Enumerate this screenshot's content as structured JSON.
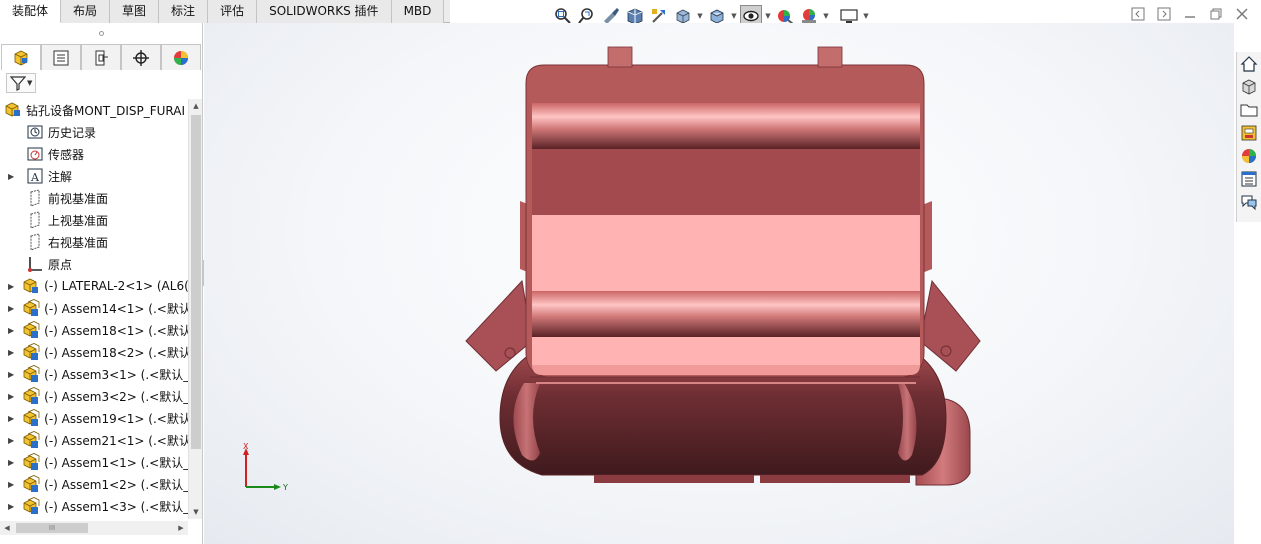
{
  "command_tabs": [
    {
      "label": "装配体",
      "active": true
    },
    {
      "label": "布局",
      "active": false
    },
    {
      "label": "草图",
      "active": false
    },
    {
      "label": "标注",
      "active": false
    },
    {
      "label": "评估",
      "active": false
    },
    {
      "label": "SOLIDWORKS 插件",
      "active": false
    },
    {
      "label": "MBD",
      "active": false
    }
  ],
  "view_toolbar": {
    "icons": [
      "zoom-to-fit-icon",
      "zoom-to-area-icon",
      "previous-view-icon",
      "section-view-icon",
      "dynamic-annotation-icon",
      "view-orientation-icon",
      "display-style-icon",
      "hide-show-items-icon",
      "edit-appearance-icon",
      "apply-scene-icon",
      "view-settings-icon"
    ]
  },
  "property_tabs": [
    "featuremanager-tree-icon",
    "propertymanager-icon",
    "configurationmanager-icon",
    "dimxpertmanager-icon",
    "displaymanager-icon"
  ],
  "tree": {
    "root": "钻孔设备MONT_DISP_FURAI",
    "items": [
      {
        "label": "历史记录",
        "icon": "history-icon",
        "expandable": false
      },
      {
        "label": "传感器",
        "icon": "sensor-icon",
        "expandable": false
      },
      {
        "label": "注解",
        "icon": "annotation-icon",
        "expandable": true
      },
      {
        "label": "前视基准面",
        "icon": "plane-icon",
        "expandable": false
      },
      {
        "label": "上视基准面",
        "icon": "plane-icon",
        "expandable": false
      },
      {
        "label": "右视基准面",
        "icon": "plane-icon",
        "expandable": false
      },
      {
        "label": "原点",
        "icon": "origin-icon",
        "expandable": false
      },
      {
        "label": "(-) LATERAL-2<1> (AL6(",
        "icon": "part-icon",
        "expandable": true
      },
      {
        "label": "(-) Assem14<1> (.<默认",
        "icon": "subassembly-icon",
        "expandable": true
      },
      {
        "label": "(-) Assem18<1> (.<默认",
        "icon": "subassembly-icon",
        "expandable": true
      },
      {
        "label": "(-) Assem18<2> (.<默认",
        "icon": "subassembly-icon",
        "expandable": true
      },
      {
        "label": "(-) Assem3<1> (.<默认_",
        "icon": "subassembly-icon",
        "expandable": true
      },
      {
        "label": "(-) Assem3<2> (.<默认_",
        "icon": "subassembly-icon",
        "expandable": true
      },
      {
        "label": "(-) Assem19<1> (.<默认",
        "icon": "subassembly-icon",
        "expandable": true
      },
      {
        "label": "(-) Assem21<1> (.<默认",
        "icon": "subassembly-icon",
        "expandable": true
      },
      {
        "label": "(-) Assem1<1> (.<默认_",
        "icon": "subassembly-icon",
        "expandable": true
      },
      {
        "label": "(-) Assem1<2> (.<默认_",
        "icon": "subassembly-icon",
        "expandable": true
      },
      {
        "label": "(-) Assem1<3> (.<默认_",
        "icon": "subassembly-icon",
        "expandable": true
      }
    ]
  },
  "scrollbar": {
    "h_thumb_label": "III"
  },
  "triad": {
    "x_label": "X",
    "y_label": "Y"
  },
  "task_pane": [
    "solidworks-resources-icon",
    "design-library-icon",
    "file-explorer-icon",
    "view-palette-icon",
    "appearances-scenes-icon",
    "custom-properties-icon",
    "forum-icon"
  ],
  "colors": {
    "model_base": "#b45a5a",
    "model_face": "#ffb3b3",
    "model_dark": "#4a1f22",
    "triad_x": "#d02020",
    "triad_y": "#1a8a1a"
  }
}
